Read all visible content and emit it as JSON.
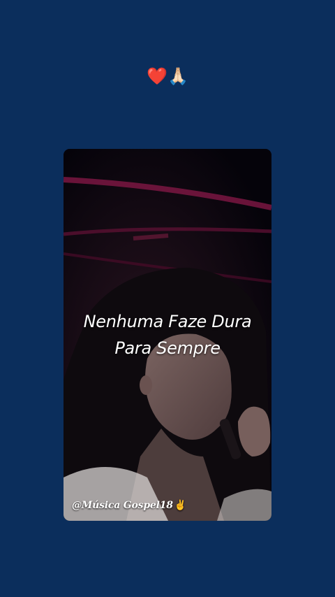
{
  "header": {
    "emojis": [
      "❤️",
      "🙏🏻"
    ]
  },
  "video": {
    "caption_lines": [
      "Nenhuma Faze Dura",
      "Para Sempre"
    ],
    "watermark": "@Música Gospel18",
    "watermark_sticker": "✌️"
  },
  "colors": {
    "background": "#0b2e5c",
    "video_dark": "#06040a",
    "stage_light": "#c2185b"
  }
}
